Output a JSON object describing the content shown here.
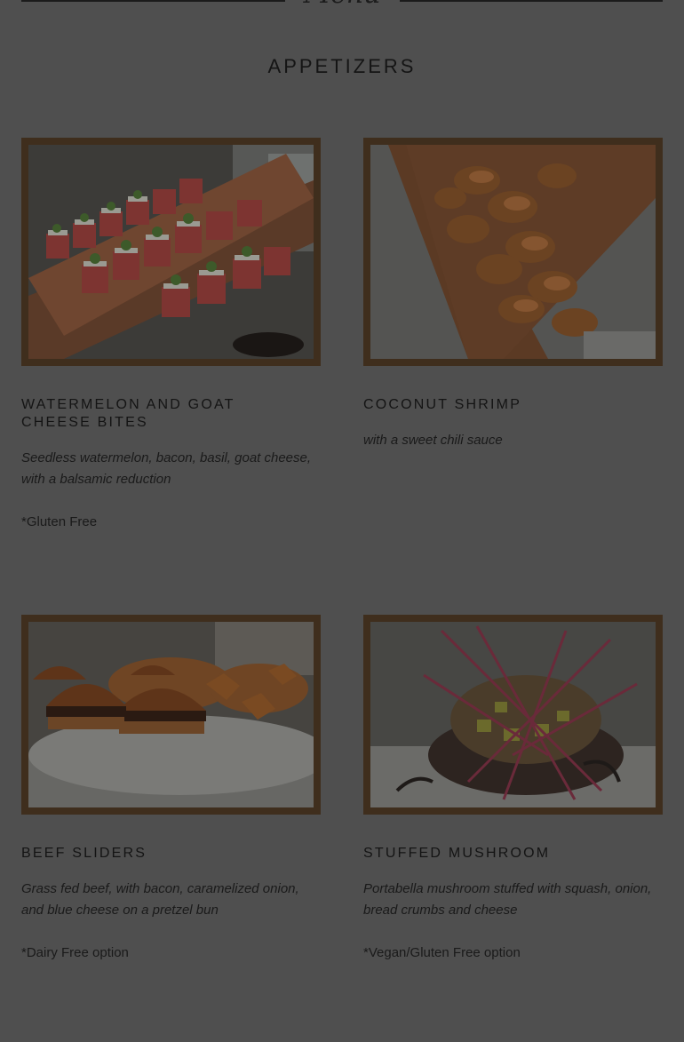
{
  "header": {
    "script_title": "Menu"
  },
  "section": {
    "title": "APPETIZERS"
  },
  "items": [
    {
      "name": "WATERMELON AND GOAT CHEESE BITES",
      "description": "Seedless watermelon, bacon, basil, goat cheese, with a balsamic reduction",
      "note": "*Gluten Free",
      "photo": "watermelon-goat-cheese-bites-photo"
    },
    {
      "name": "COCONUT SHRIMP",
      "description": "with a sweet chili sauce",
      "note": "",
      "photo": "coconut-shrimp-photo"
    },
    {
      "name": "BEEF SLIDERS",
      "description": "Grass fed beef, with bacon, caramelized onion, and blue cheese on a pretzel bun",
      "note": "*Dairy Free option",
      "photo": "beef-sliders-photo"
    },
    {
      "name": "STUFFED MUSHROOM",
      "description": "Portabella mushroom stuffed with squash, onion, bread crumbs and cheese",
      "note": "*Vegan/Gluten Free option",
      "photo": "stuffed-mushroom-photo"
    }
  ],
  "colors": {
    "overlay_background": "#4f4f4f",
    "frame": "#3f2e1d",
    "text": "#171717"
  }
}
